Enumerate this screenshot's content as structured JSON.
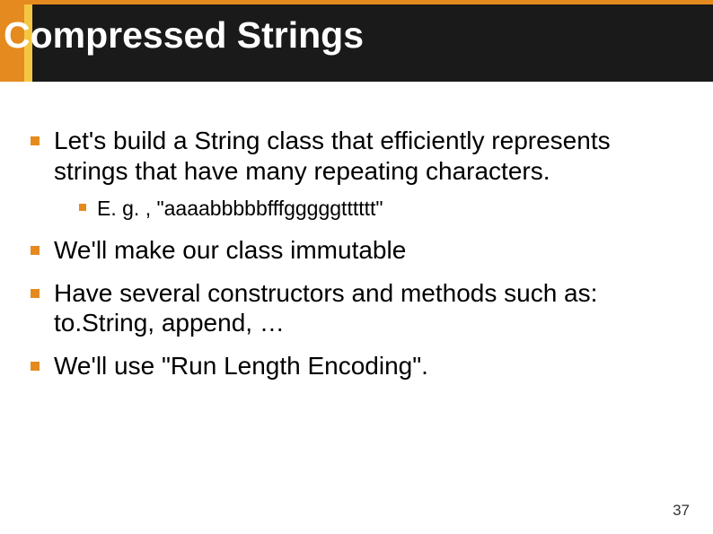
{
  "slide": {
    "title": "Compressed Strings",
    "bullets": [
      {
        "text": "Let's build a String class that efficiently represents strings that have many repeating characters.",
        "sub": [
          {
            "text": "E. g. , \"aaaabbbbbfffgggggtttttt\""
          }
        ]
      },
      {
        "text": "We'll make our class immutable"
      },
      {
        "text": "Have several constructors and methods such as: to.String, append, …"
      },
      {
        "text": "We'll use \"Run Length Encoding\"."
      }
    ],
    "page_number": "37"
  }
}
